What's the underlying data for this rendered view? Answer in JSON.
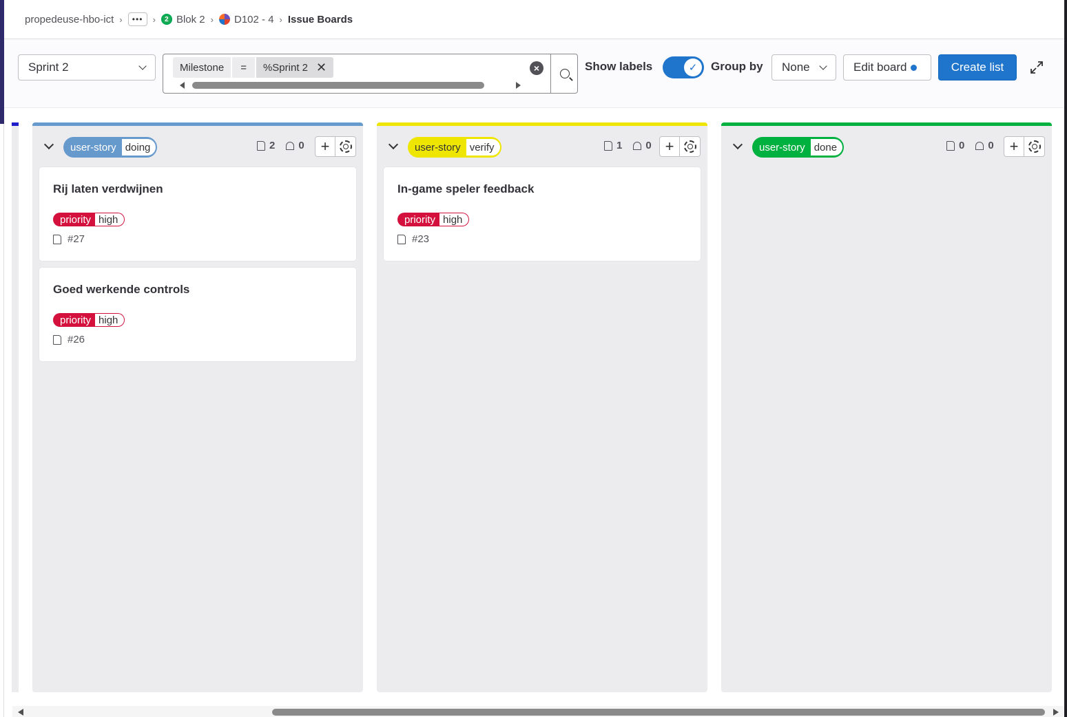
{
  "breadcrumb": {
    "items": [
      {
        "label": "propedeuse-hbo-ict"
      },
      {
        "label": "•••"
      },
      {
        "label": "Blok 2",
        "avatar": "2"
      },
      {
        "label": "D102 - 4"
      },
      {
        "label": "Issue Boards"
      }
    ]
  },
  "toolbar": {
    "board_select": "Sprint 2",
    "filter": {
      "token_field": "Milestone",
      "token_operator": "=",
      "token_value": "%Sprint 2"
    },
    "show_labels_label": "Show labels",
    "show_labels_on": true,
    "group_by_label": "Group by",
    "group_by_value": "None",
    "edit_board_label": "Edit board",
    "create_list_label": "Create list"
  },
  "lists": [
    {
      "scope": "user-story",
      "value": "doing",
      "color": "#6699cc",
      "issues_count": "2",
      "weight_count": "0",
      "cards": [
        {
          "title": "Rij laten verdwijnen",
          "label_scope": "priority",
          "label_value": "high",
          "ref": "#27"
        },
        {
          "title": "Goed werkende controls",
          "label_scope": "priority",
          "label_value": "high",
          "ref": "#26"
        }
      ]
    },
    {
      "scope": "user-story",
      "value": "verify",
      "color": "#eee600",
      "issues_count": "1",
      "weight_count": "0",
      "cards": [
        {
          "title": "In-game speler feedback",
          "label_scope": "priority",
          "label_value": "high",
          "ref": "#23"
        }
      ]
    },
    {
      "scope": "user-story",
      "value": "done",
      "color": "#00b140",
      "issues_count": "0",
      "weight_count": "0",
      "cards": []
    }
  ],
  "colors": {
    "accent": "#1f75cb",
    "priority": "#d4113d"
  }
}
